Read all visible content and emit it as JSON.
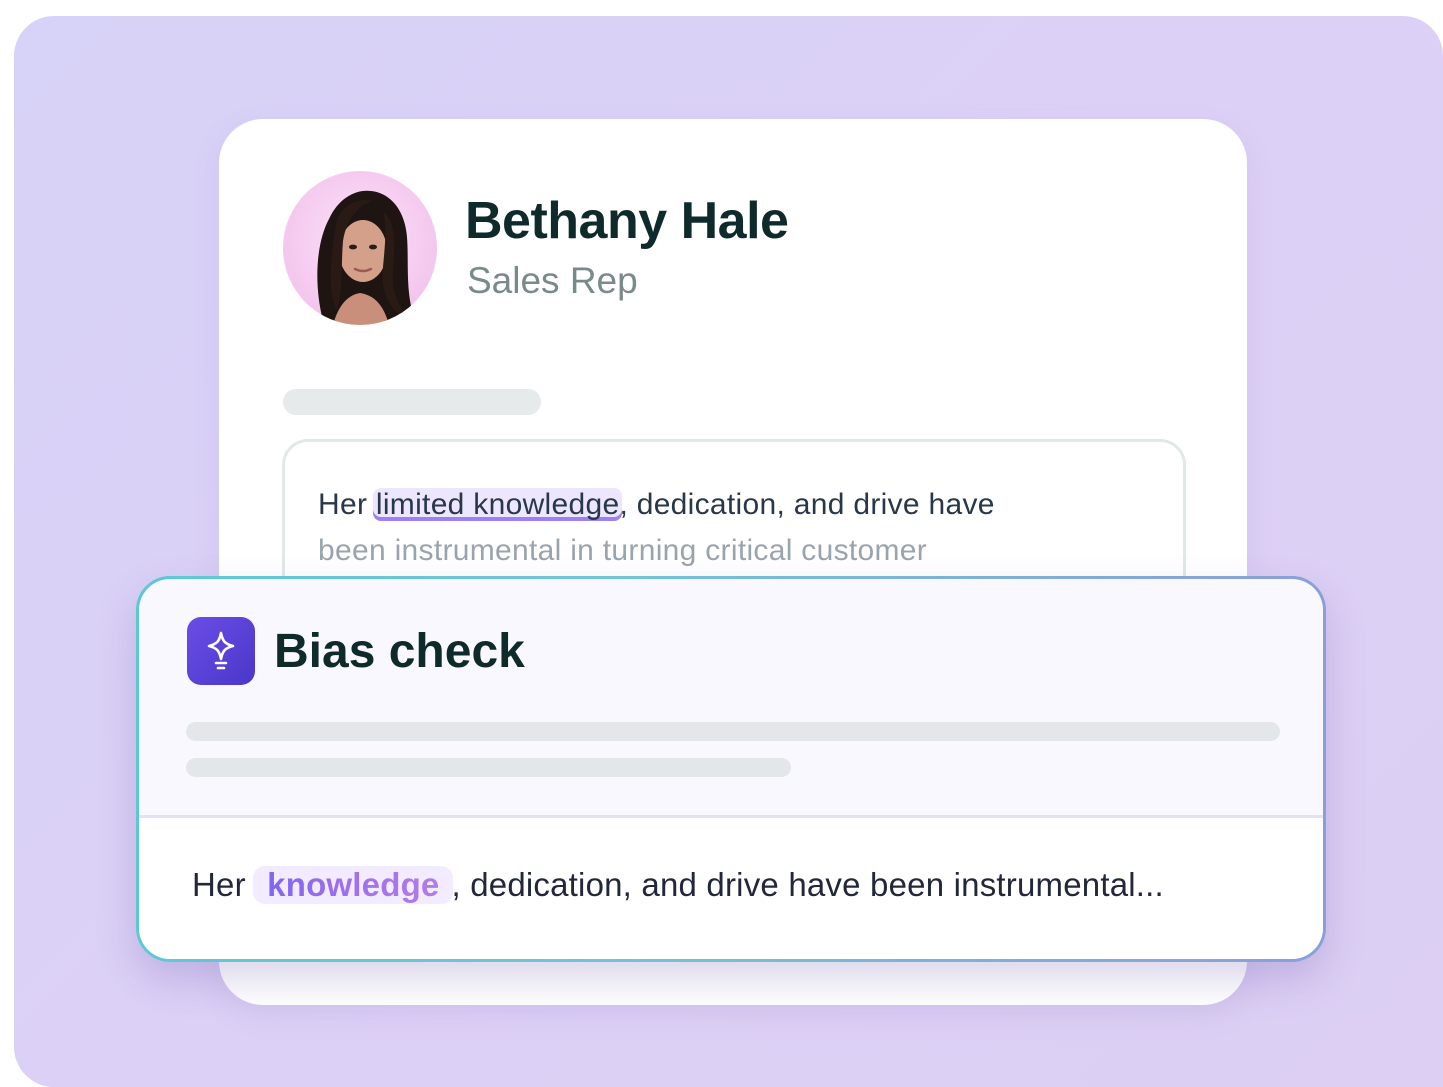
{
  "profile": {
    "name": "Bethany Hale",
    "role": "Sales Rep"
  },
  "review": {
    "line1_prefix": "Her ",
    "flagged_phrase": "limited knowledge",
    "line1_suffix": ", dedication, and drive have",
    "line2": "been instrumental in turning critical customer"
  },
  "bias_check": {
    "title": "Bias check",
    "icon": "sparkle-lightbulb-icon",
    "suggestion_prefix": "Her ",
    "suggested_word": "knowledge",
    "suggestion_suffix": ", dedication, and drive have been instrumental..."
  },
  "colors": {
    "accent": "#5b40d9",
    "highlight": "#ede6ff",
    "underline": "#9d80f5",
    "title": "#0f2a2a"
  }
}
